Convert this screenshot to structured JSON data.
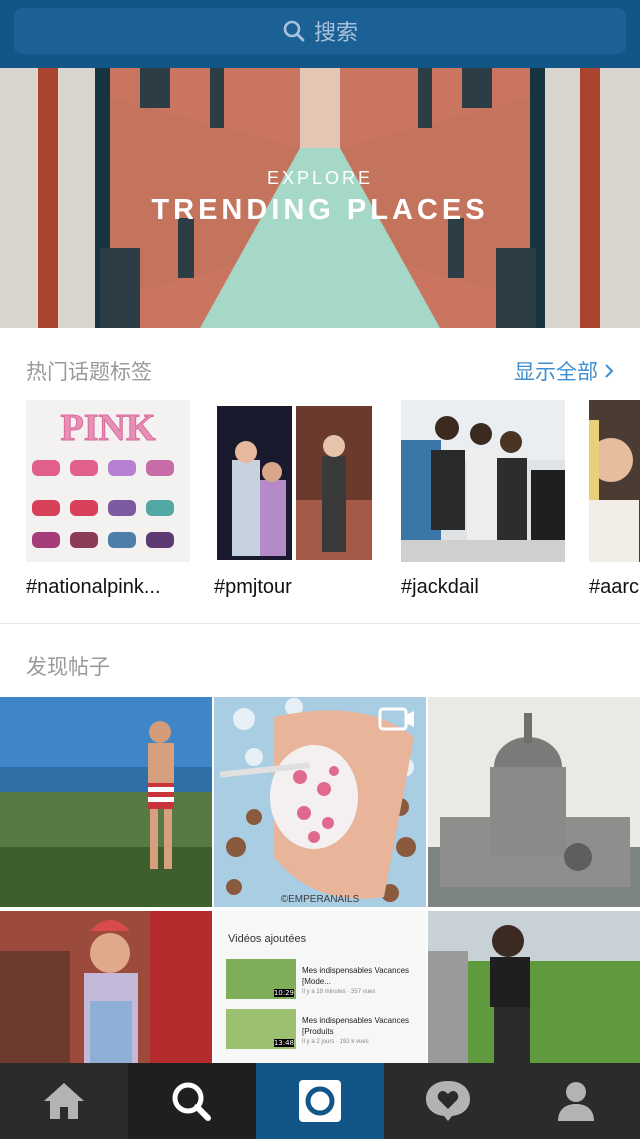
{
  "search": {
    "placeholder": "搜索"
  },
  "banner": {
    "kicker": "EXPLORE",
    "title": "TRENDING PLACES"
  },
  "tags_section": {
    "heading": "热门话题标签",
    "show_all": "显示全部",
    "items": [
      {
        "label": "#nationalpink...",
        "thumb_text": "PINK"
      },
      {
        "label": "#pmjtour"
      },
      {
        "label": "#jackdail"
      },
      {
        "label": "#aarc"
      }
    ]
  },
  "discover_section": {
    "heading": "发现帖子"
  },
  "grid": {
    "video_card": {
      "header": "Vidéos ajoutées",
      "items": [
        {
          "title": "Mes indispensables Vacances [Mode...",
          "meta": "Il y a 19 minutes · 357 vues",
          "duration": "10:29"
        },
        {
          "title": "Mes indispensables Vacances [Produits",
          "meta": "Il y a 2 jours · 192 k vues",
          "duration": "13:48"
        }
      ]
    },
    "watermark": "©EMPERANAILS"
  },
  "nav": {
    "items": [
      "home",
      "search",
      "camera",
      "activity",
      "profile"
    ],
    "active": "camera"
  },
  "colors": {
    "header": "#125688",
    "link": "#3f8fd0",
    "nav": "#2b2b2b"
  }
}
